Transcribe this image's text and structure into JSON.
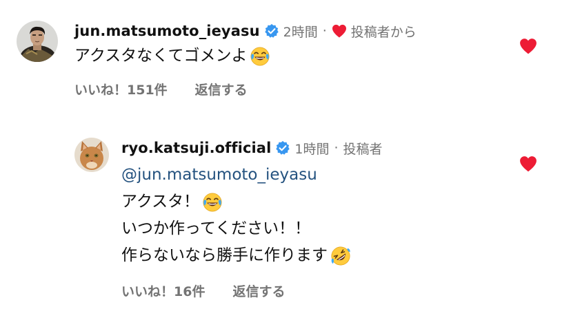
{
  "comments": [
    {
      "username": "jun.matsumoto_ieyasu",
      "time": "2時間",
      "author_label": "投稿者から",
      "lines": [
        "アクスタなくてゴメンよ"
      ],
      "likes": "いいね！151件",
      "reply": "返信する",
      "emoji": "face-with-tears-of-joy"
    },
    {
      "username": "ryo.katsuji.official",
      "time": "1時間",
      "author_label": "投稿者",
      "mention": "@jun.matsumoto_ieyasu",
      "lines": [
        "アクスタ！",
        "いつか作ってください！！",
        "作らないなら勝手に作ります"
      ],
      "likes": "いいね！16件",
      "reply": "返信する",
      "emojis": [
        "face-with-tears-of-joy",
        "rolling-on-the-floor-laughing"
      ]
    }
  ],
  "colors": {
    "text": "#111111",
    "secondary": "#737373",
    "mention": "#24527f",
    "heart": "#ed1c35",
    "verified": "#3897f0"
  }
}
